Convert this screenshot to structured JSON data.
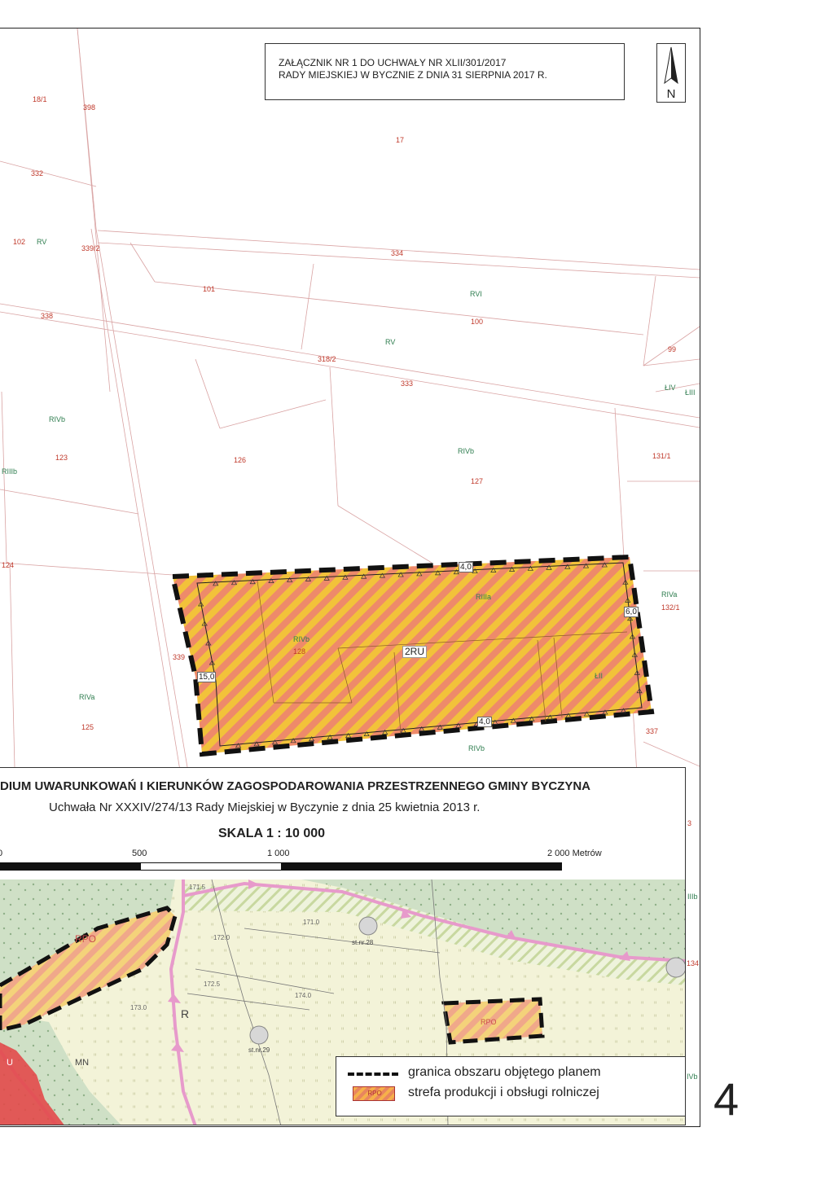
{
  "header": {
    "attachment_line1": "ZAŁĄCZNIK NR 1 DO UCHWAŁY NR XLII/301/2017",
    "attachment_line2": "RADY MIEJSKIEJ W BYCZNIE Z DNIA 31 SIERPNIA 2017 R.",
    "north_letter": "N"
  },
  "main_map": {
    "zone_label": "2RU",
    "dimensions": {
      "north": "4,0",
      "east": "6,0",
      "west": "15,0",
      "south": "4,0"
    },
    "parcel_numbers": [
      "18/1",
      "398",
      "17",
      "332",
      "102",
      "339/2",
      "334",
      "101",
      "338",
      "100",
      "318/2",
      "99",
      "333",
      "123",
      "126",
      "127",
      "131/1",
      "124",
      "132/1",
      "339",
      "128",
      "125",
      "337"
    ],
    "soil_classes": [
      "RV",
      "RVI",
      "RV",
      "ŁIV",
      "ŁIII",
      "RIVb",
      "RIVb",
      "RIIIb",
      "RIIIa",
      "RIVa",
      "RIVb",
      "ŁII",
      "RIVa",
      "RIVb"
    ]
  },
  "study": {
    "title": "DIUM UWARUNKOWAŃ I KIERUNKÓW ZAGOSPODAROWANIA PRZESTRZENNEGO GMINY BYCZYNA",
    "resolution": "Uchwała Nr XXXIV/274/13 Rady Miejskiej w Byczynie z dnia 25 kwietnia 2013 r.",
    "scale": "SKALA 1 : 10 000",
    "scale_labels": [
      "0",
      "500",
      "1 000",
      "2 000 Metrów"
    ],
    "map_labels": {
      "rpo_west": "RPO",
      "rpo_east": "RPO",
      "site_west": "st.nr.28",
      "site_south": "st.nr.29",
      "heights": [
        "171.5",
        "172.0",
        "172.5",
        "173.0",
        "174.0",
        "171.0"
      ],
      "letter_r": "R",
      "letter_u": "U",
      "letter_mn": "MN",
      "edge_labels": [
        "3",
        "IIIb",
        "134",
        "IVb"
      ]
    }
  },
  "legend": {
    "items": [
      {
        "label": "granica obszaru objętego planem"
      },
      {
        "label": "strefa produkcji i obsługi rolniczej",
        "swatch_text": "RPO"
      }
    ]
  },
  "page_number": "4"
}
